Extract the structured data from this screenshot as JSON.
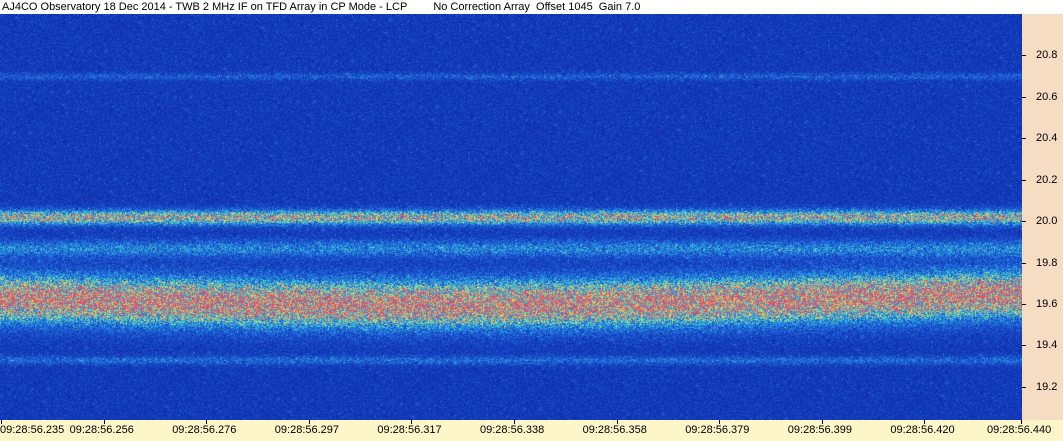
{
  "header": {
    "title": "AJ4CO Observatory 18 Dec 2014 - TWB 2 MHz IF on TFD Array in CP Mode - LCP",
    "status": "No Correction Array  Offset 1045  Gain 7.0"
  },
  "chart_data": {
    "type": "heatmap",
    "x_tick_labels": [
      "09:28:56.235",
      "09:28:56.256",
      "09:28:56.276",
      "09:28:56.297",
      "09:28:56.317",
      "09:28:56.338",
      "09:28:56.358",
      "09:28:56.379",
      "09:28:56.399",
      "09:28:56.420",
      "09:28:56.440"
    ],
    "y_ticks": [
      19.2,
      19.4,
      19.6,
      19.8,
      20.0,
      20.2,
      20.4,
      20.6,
      20.8
    ],
    "y_tick_labels": [
      "19.2",
      "19.4",
      "19.6",
      "19.8",
      "20.0",
      "20.2",
      "20.4",
      "20.6",
      "20.8"
    ],
    "ylim": [
      19.04,
      21.0
    ],
    "bands": [
      {
        "center": 19.63,
        "width": 0.08,
        "intensity": 1.0
      },
      {
        "center": 20.02,
        "width": 0.025,
        "intensity": 0.75
      },
      {
        "center": 19.87,
        "width": 0.03,
        "intensity": 0.35
      },
      {
        "center": 19.33,
        "width": 0.015,
        "intensity": 0.25
      },
      {
        "center": 20.7,
        "width": 0.012,
        "intensity": 0.2
      }
    ],
    "colors": {
      "background": "#1a3fb0",
      "low": "#0a2aa0",
      "mid": "#2aa8e0",
      "high": "#f0e050",
      "peak": "#e06060",
      "y_axis_panel": "#f7dcc4",
      "x_axis_panel": "#fdf6c9"
    }
  }
}
